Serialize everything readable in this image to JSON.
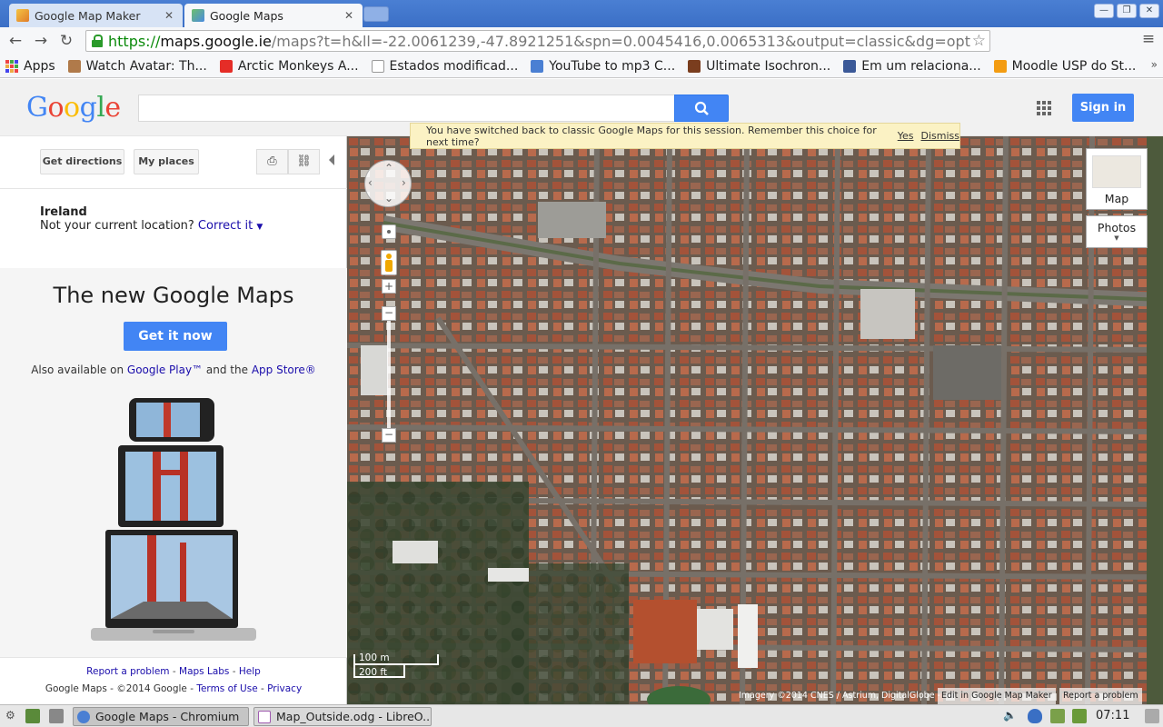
{
  "browser": {
    "tabs": [
      {
        "title": "Google Map Maker",
        "active": false
      },
      {
        "title": "Google Maps",
        "active": true
      }
    ],
    "url": {
      "scheme": "https://",
      "host": "maps.google.ie",
      "rest": "/maps?t=h&ll=-22.0061239,-47.8921251&spn=0.0045416,0.0065313&output=classic&dg=opt"
    },
    "bookmarks": [
      "Apps",
      "Watch Avatar: Th...",
      "Arctic Monkeys A...",
      "Estados modificad...",
      "YouTube to mp3 C...",
      "Ultimate Isochron...",
      "Em um relaciona...",
      "Moodle USP do St..."
    ]
  },
  "header": {
    "logo": "Google",
    "signin_label": "Sign in"
  },
  "left_panel": {
    "get_directions": "Get directions",
    "my_places": "My places",
    "location_title": "Ireland",
    "location_sub": "Not your current location?",
    "correct_it": "Correct it",
    "promo_title": "The new Google Maps",
    "get_it_now": "Get it now",
    "also_available": "Also available on",
    "google_play": "Google Play™",
    "and_the": "and the",
    "app_store": "App Store®",
    "footer": {
      "report": "Report a problem",
      "labs": "Maps Labs",
      "help": "Help",
      "brand": "Google Maps",
      "copyright": "- ©2014 Google",
      "terms": "Terms of Use",
      "privacy": "Privacy"
    }
  },
  "map": {
    "notice_text": "You have switched back to classic Google Maps for this session. Remember this choice for next time?",
    "notice_yes": "Yes",
    "notice_dismiss": "Dismiss",
    "map_type_map": "Map",
    "map_type_photos": "Photos",
    "scale_m": "100 m",
    "scale_ft": "200 ft",
    "attribution": "Imagery ©2014 CNES / Astrium, DigitalGlobe -",
    "edit_link": "Edit in Google Map Maker",
    "report_link": "Report a problem"
  },
  "taskbar": {
    "tasks": [
      "Google Maps - Chromium",
      "Map_Outside.odg - LibreO..."
    ],
    "clock": "07:11"
  },
  "colors": {
    "accent": "#4285f4",
    "link": "#1a0dab",
    "notice_bg": "#fbf2c4"
  }
}
